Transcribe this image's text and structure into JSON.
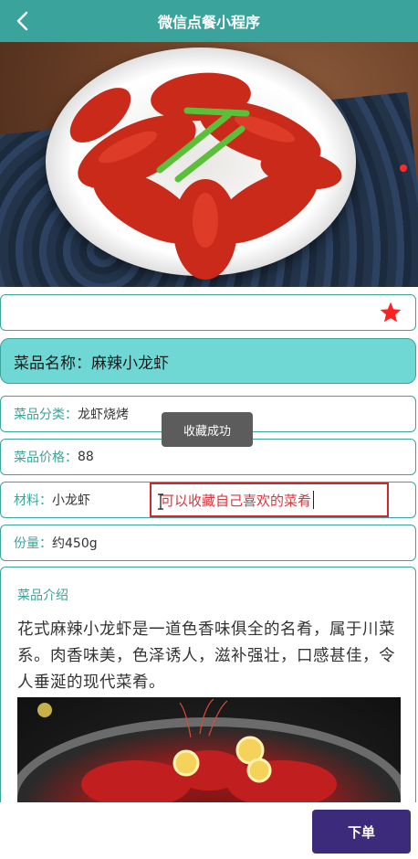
{
  "header": {
    "title": "微信点餐小程序",
    "back_icon": "chevron-left-icon"
  },
  "hero": {
    "image": "spicy-crayfish-plate",
    "carousel_indicator_color": "#ff2b2b"
  },
  "favorite": {
    "icon": "star-icon",
    "color": "#ff2020"
  },
  "dish": {
    "name_label": "菜品名称：",
    "name_value": "麻辣小龙虾"
  },
  "fields": [
    {
      "label": "菜品分类：",
      "value": "龙虾烧烤"
    },
    {
      "label": "菜品价格：",
      "value": "88"
    },
    {
      "label": "材料：",
      "value": "小龙虾"
    },
    {
      "label": "份量：",
      "value": "约450g"
    }
  ],
  "toast": {
    "text": "收藏成功"
  },
  "annotation": {
    "text": "可以收藏自己喜欢的菜肴"
  },
  "intro": {
    "heading": "菜品介绍",
    "text": "花式麻辣小龙虾是一道色香味俱全的名肴，属于川菜系。肉香味美，色泽诱人，滋补强壮，口感甚佳，令人垂涎的现代菜肴。",
    "image": "crayfish-with-lemon"
  },
  "order_button": {
    "label": "下单"
  },
  "colors": {
    "accent": "#3aa39c",
    "name_card": "#6fd8d5",
    "order_button": "#3c2a7a",
    "annotation": "#d9363e"
  }
}
